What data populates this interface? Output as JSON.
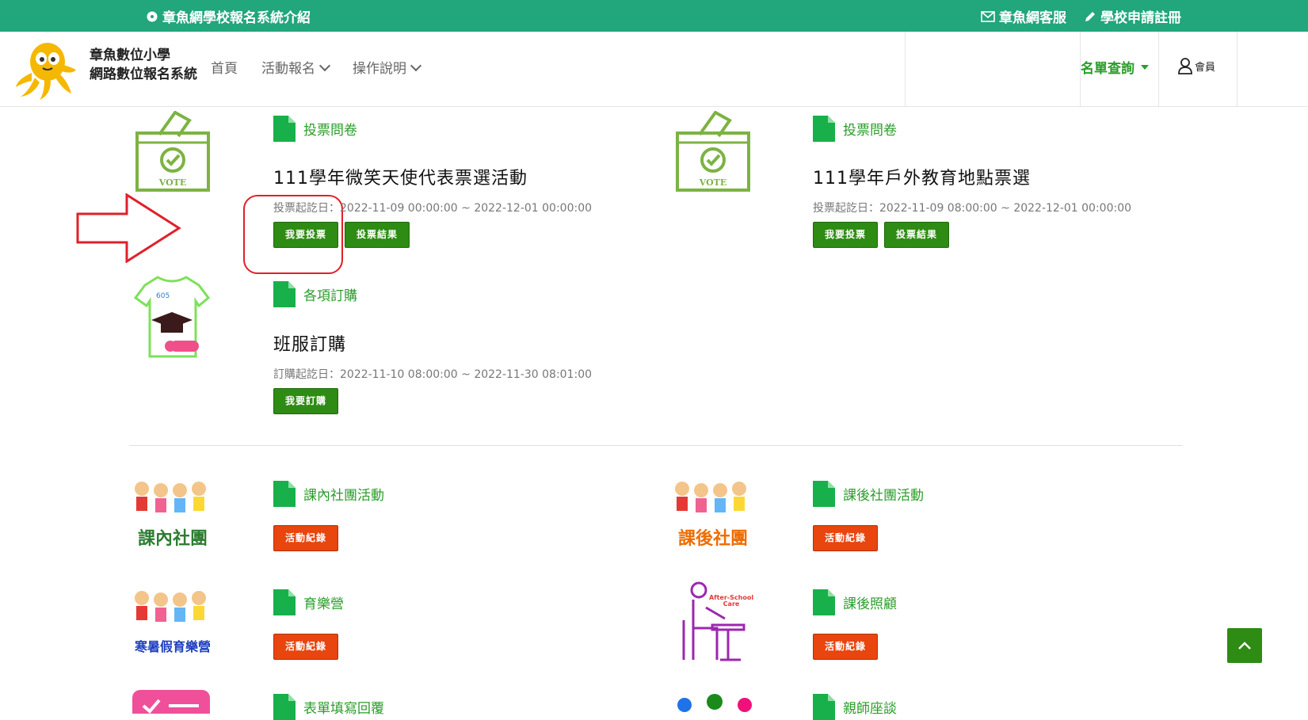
{
  "topbar": {
    "intro": "章魚網學校報名系統介紹",
    "service": "章魚網客服",
    "register": "學校申請註冊"
  },
  "nav": {
    "brand_line1": "章魚數位小學",
    "brand_line2": "網路數位報名系統",
    "home": "首頁",
    "activity": "活動報名",
    "guide": "操作說明",
    "query": "名單查詢",
    "member": "會員"
  },
  "cards": {
    "vote1": {
      "category": "投票問卷",
      "title": "111學年微笑天使代表票選活動",
      "dates": "投票起訖日：2022-11-09 00:00:00 ~ 2022-12-01 00:00:00",
      "btn_vote": "我要投票",
      "btn_result": "投票結果",
      "img_text": "VOTE"
    },
    "vote2": {
      "category": "投票問卷",
      "title": "111學年戶外教育地點票選",
      "dates": "投票起訖日：2022-11-09 08:00:00 ~ 2022-12-01 00:00:00",
      "btn_vote": "我要投票",
      "btn_result": "投票結果",
      "img_text": "VOTE"
    },
    "order": {
      "category": "各項訂購",
      "title": "班服訂購",
      "dates": "訂購起訖日：2022-11-10 08:00:00 ~ 2022-11-30 08:01:00",
      "btn": "我要訂購",
      "shirt_text": "605"
    },
    "club_in": {
      "category": "課內社團活動",
      "btn": "活動紀錄",
      "img_text": "課內社團"
    },
    "club_after": {
      "category": "課後社團活動",
      "btn": "活動紀錄",
      "img_text": "課後社團"
    },
    "camp": {
      "category": "育樂營",
      "btn": "活動紀錄",
      "img_text": "寒暑假育樂營"
    },
    "care": {
      "category": "課後照顧",
      "btn": "活動紀錄",
      "img_text1": "After-School",
      "img_text2": "Care"
    },
    "survey": {
      "category": "表單填寫回覆"
    },
    "talk": {
      "category": "親師座談"
    }
  },
  "colors": {
    "topbar": "#22a67c",
    "green_button": "#2e8b13",
    "orange_button": "#e8450f",
    "category_text": "#2a9d2a",
    "highlight_red": "#e0202a"
  }
}
